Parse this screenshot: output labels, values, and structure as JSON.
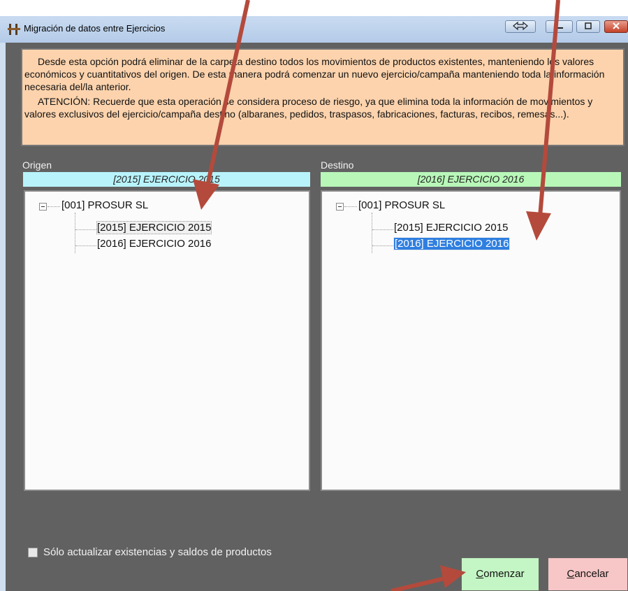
{
  "window": {
    "title": "Migración de datos entre Ejercicios",
    "buttons": [
      "restore-toggle",
      "minimize",
      "maximize",
      "close"
    ]
  },
  "info": {
    "paragraph1": "Desde esta opción podrá eliminar de la carpeta destino todos los movimientos de productos existentes, manteniendo los valores económicos y cuantitativos del origen. De esta manera podrá comenzar un nuevo ejercicio/campaña manteniendo toda la información necesaria del/la anterior.",
    "paragraph2": "ATENCIÓN: Recuerde que esta operación se considera proceso de riesgo, ya que elimina toda la información de movimientos y valores exclusivos del ejercicio/campaña destino (albaranes, pedidos, traspasos, fabricaciones, facturas, recibos, remesas...)."
  },
  "origin": {
    "label": "Origen",
    "selected": "[2015] EJERCICIO 2015",
    "tree": {
      "root": "[001] PROSUR SL",
      "children": [
        "[2015] EJERCICIO 2015",
        "[2016] EJERCICIO 2016"
      ]
    }
  },
  "destination": {
    "label": "Destino",
    "selected": "[2016] EJERCICIO 2016",
    "tree": {
      "root": "[001] PROSUR SL",
      "children": [
        "[2015] EJERCICIO 2015",
        "[2016] EJERCICIO 2016"
      ]
    }
  },
  "checkbox": {
    "label": "Sólo actualizar existencias y saldos de productos",
    "checked": false
  },
  "actions": {
    "start_accel": "C",
    "start_rest": "omenzar",
    "cancel_accel": "C",
    "cancel_rest": "ancelar"
  },
  "colors": {
    "info_bg": "#fcd3ad",
    "origin_band": "#b8f3fb",
    "destination_band": "#b8f7b8",
    "start_button": "#c4f5c4",
    "cancel_button": "#f7c6c6",
    "selection": "#2f7fe0",
    "arrow": "#b44a3c"
  }
}
